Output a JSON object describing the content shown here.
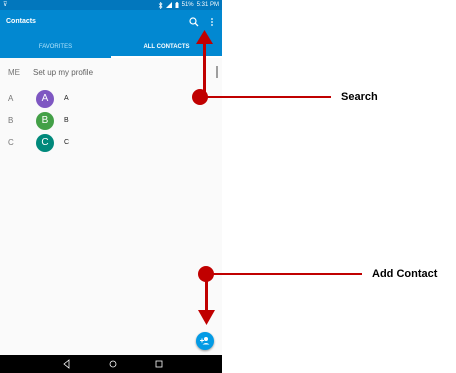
{
  "status_bar": {
    "time": "5:31 PM",
    "battery": "51%"
  },
  "app_bar": {
    "title": "Contacts"
  },
  "tabs": [
    {
      "label": "FAVORITES"
    },
    {
      "label": "ALL CONTACTS"
    }
  ],
  "profile_row": {
    "label": "ME",
    "text": "Set up my profile"
  },
  "contacts": [
    {
      "section": "A",
      "initial": "A",
      "name": "A",
      "color": "#7e57c2"
    },
    {
      "section": "B",
      "initial": "B",
      "name": "B",
      "color": "#43a047"
    },
    {
      "section": "C",
      "initial": "C",
      "name": "C",
      "color": "#00897b"
    }
  ],
  "callouts": [
    {
      "label": "Search"
    },
    {
      "label": "Add Contact"
    }
  ],
  "colors": {
    "app_bar": "#0288d1",
    "status_bar": "#0277bd",
    "fab": "#039be5",
    "callout": "#c00000"
  }
}
